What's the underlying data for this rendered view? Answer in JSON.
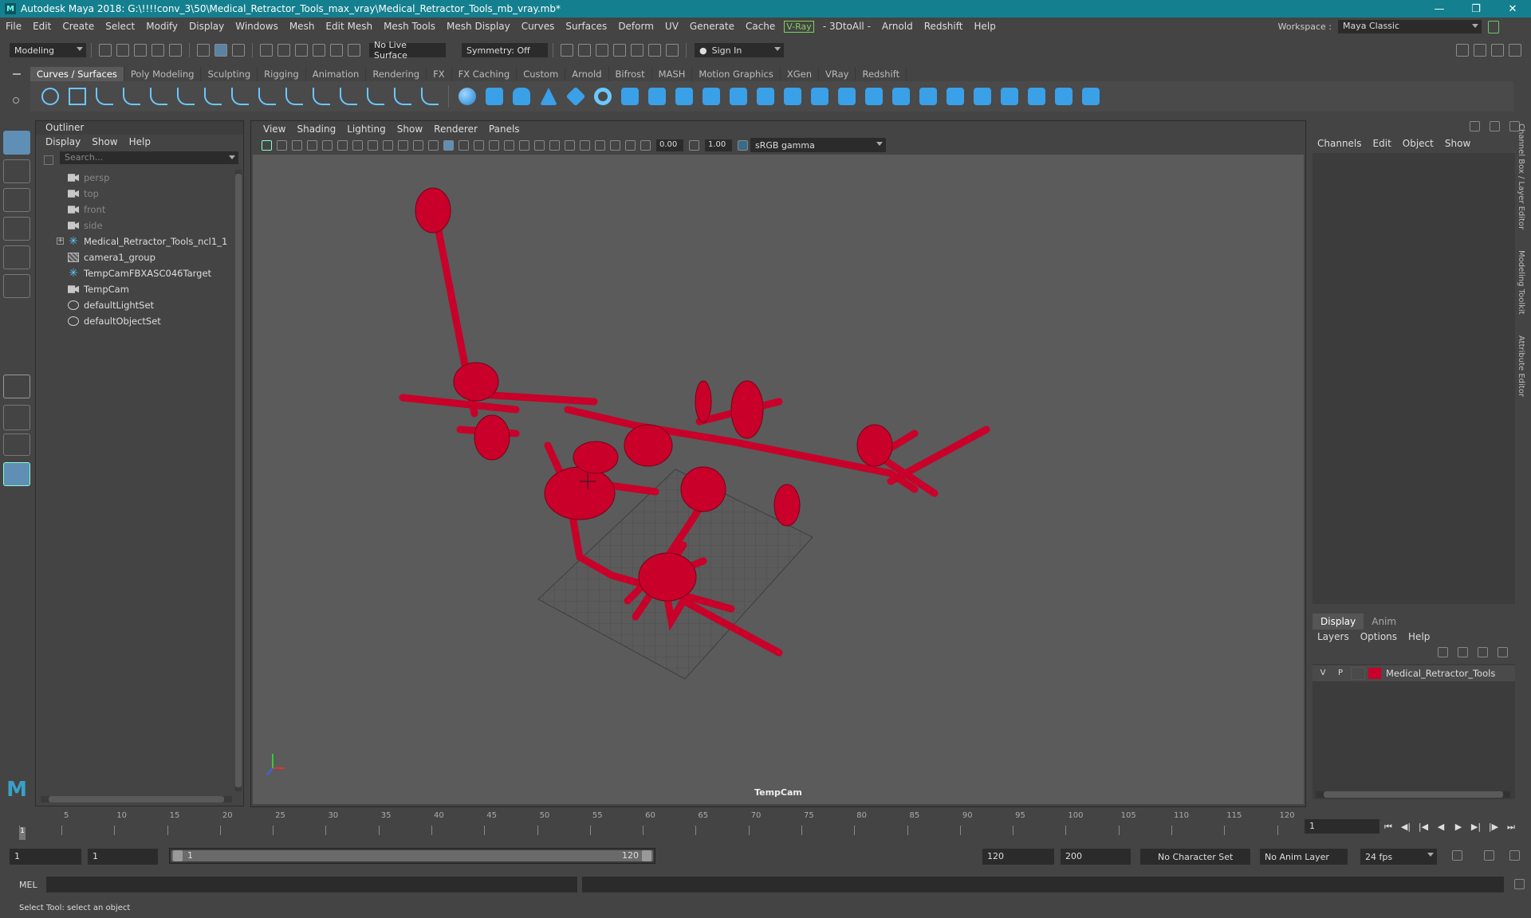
{
  "window": {
    "title": "Autodesk Maya 2018: G:\\!!!!conv_3\\50\\Medical_Retractor_Tools_max_vray\\Medical_Retractor_Tools_mb_vray.mb*"
  },
  "menus": [
    "File",
    "Edit",
    "Create",
    "Select",
    "Modify",
    "Display",
    "Windows",
    "Mesh",
    "Edit Mesh",
    "Mesh Tools",
    "Mesh Display",
    "Curves",
    "Surfaces",
    "Deform",
    "UV",
    "Generate",
    "Cache"
  ],
  "menus_after": [
    "- 3DtoAll -",
    "Arnold",
    "Redshift",
    "Help"
  ],
  "vray_label": "V-Ray",
  "workspace": {
    "label": "Workspace :",
    "value": "Maya Classic"
  },
  "status": {
    "mode": "Modeling",
    "live_surface": "No Live Surface",
    "symmetry": "Symmetry: Off",
    "sign_in": "Sign In"
  },
  "shelf_tabs": [
    "Curves / Surfaces",
    "Poly Modeling",
    "Sculpting",
    "Rigging",
    "Animation",
    "Rendering",
    "FX",
    "FX Caching",
    "Custom",
    "Arnold",
    "Bifrost",
    "MASH",
    "Motion Graphics",
    "XGen",
    "VRay",
    "Redshift"
  ],
  "outliner": {
    "title": "Outliner",
    "menu": [
      "Display",
      "Show",
      "Help"
    ],
    "search_placeholder": "Search...",
    "items": [
      {
        "label": "persp",
        "icon": "camera-icon",
        "dim": true
      },
      {
        "label": "top",
        "icon": "camera-icon",
        "dim": true
      },
      {
        "label": "front",
        "icon": "camera-icon",
        "dim": true
      },
      {
        "label": "side",
        "icon": "camera-icon",
        "dim": true
      },
      {
        "label": "Medical_Retractor_Tools_ncl1_1",
        "icon": "locator-icon",
        "dim": false,
        "expand": true
      },
      {
        "label": "camera1_group",
        "icon": "group-icon",
        "dim": false
      },
      {
        "label": "TempCamFBXASC046Target",
        "icon": "locator-icon",
        "dim": false
      },
      {
        "label": "TempCam",
        "icon": "camera-icon",
        "dim": false
      },
      {
        "label": "defaultLightSet",
        "icon": "set-icon",
        "dim": false
      },
      {
        "label": "defaultObjectSet",
        "icon": "set-icon",
        "dim": false
      }
    ]
  },
  "viewport": {
    "menu": [
      "View",
      "Shading",
      "Lighting",
      "Show",
      "Renderer",
      "Panels"
    ],
    "exposure": "0.00",
    "gamma": "1.00",
    "color_space": "sRGB gamma",
    "camera": "TempCam",
    "wire_color": "#c8002a"
  },
  "channelbox": {
    "menu": [
      "Channels",
      "Edit",
      "Object",
      "Show"
    ]
  },
  "layers": {
    "tabs": [
      "Display",
      "Anim"
    ],
    "menu": [
      "Layers",
      "Options",
      "Help"
    ],
    "rows": [
      {
        "v": "V",
        "p": "P",
        "name": "Medical_Retractor_Tools",
        "color": "#c8002a"
      }
    ]
  },
  "side_tabs": [
    "Channel Box / Layer Editor",
    "Modeling Toolkit",
    "Attribute Editor"
  ],
  "timeline": {
    "ticks": [
      5,
      10,
      15,
      20,
      25,
      30,
      35,
      40,
      45,
      50,
      55,
      60,
      65,
      70,
      75,
      80,
      85,
      90,
      95,
      100,
      105,
      110,
      115,
      120
    ],
    "current_frame_marker": "1",
    "current_frame": "1"
  },
  "range": {
    "start": "1",
    "anim_start": "1",
    "range_start": "1",
    "range_end": "120",
    "anim_end": "120",
    "end": "200",
    "character_set": "No Character Set",
    "anim_layer": "No Anim Layer",
    "fps": "24 fps"
  },
  "mel": {
    "label": "MEL"
  },
  "help_line": "Select Tool: select an object"
}
